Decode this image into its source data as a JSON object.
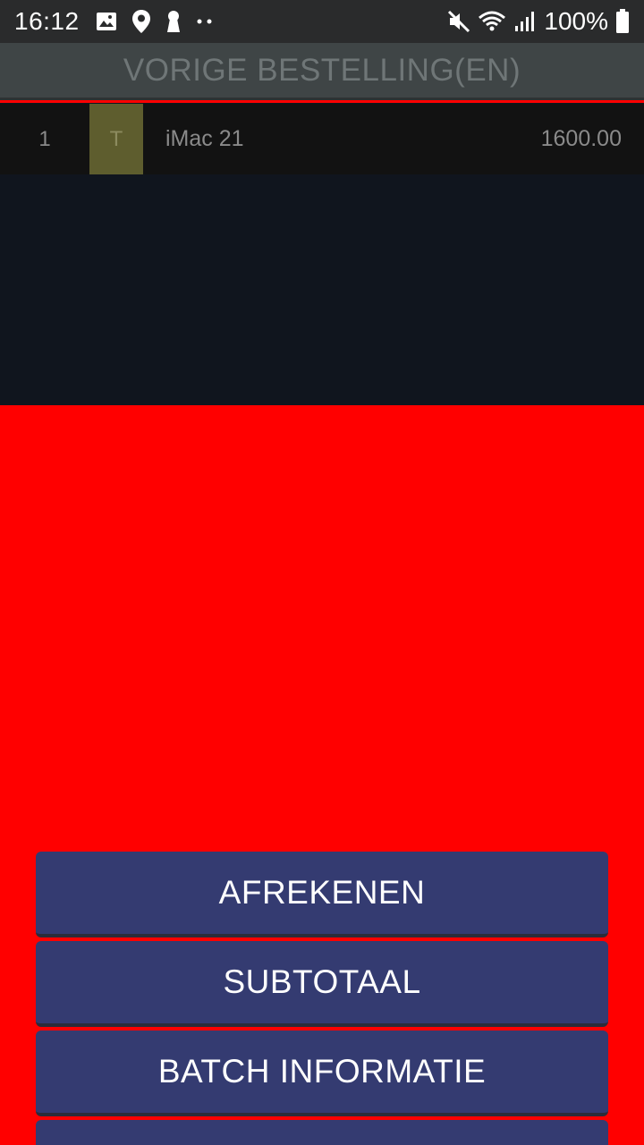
{
  "status_bar": {
    "time": "16:12",
    "battery": "100%",
    "icons": [
      "image-icon",
      "location-icon",
      "keyhole-icon",
      "more-dots-icon",
      "mute-icon",
      "wifi-icon",
      "signal-icon",
      "battery-icon"
    ]
  },
  "header": {
    "title": "VORIGE BESTELLING(EN)"
  },
  "orders": [
    {
      "qty": "1",
      "tag": "T",
      "name": "iMac 21",
      "price": "1600.00"
    }
  ],
  "buttons": {
    "checkout": "AFREKENEN",
    "subtotal": "SUBTOTAAL",
    "batch_info": "BATCH INFORMATIE"
  },
  "colors": {
    "background": "#ff0000",
    "button": "#343b71",
    "title_bar": "#3f4546",
    "tag": "#5e5d2e"
  }
}
